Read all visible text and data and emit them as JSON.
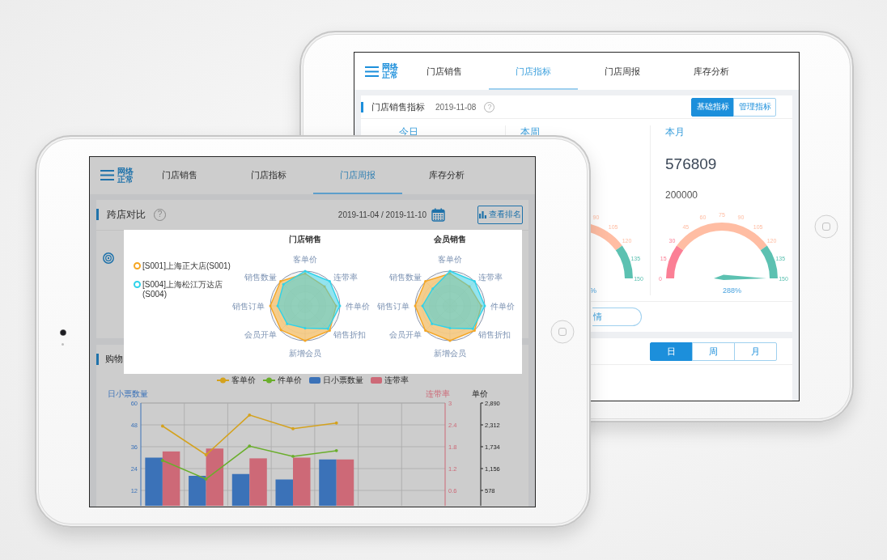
{
  "back_tablet": {
    "header": {
      "network_status": "网络正常",
      "tabs": [
        {
          "label": "门店销售",
          "selected": false
        },
        {
          "label": "门店指标",
          "selected": true
        },
        {
          "label": "门店周报",
          "selected": false
        },
        {
          "label": "库存分析",
          "selected": false
        }
      ]
    },
    "indicator_card": {
      "title": "门店销售指标",
      "date": "2019-11-08",
      "help": "?",
      "modes": [
        {
          "label": "基础指标",
          "selected": true
        },
        {
          "label": "管理指标",
          "selected": false
        }
      ],
      "periods": [
        {
          "label": "今日"
        },
        {
          "label": "本周",
          "gauge": {
            "ticks": [
              "90",
              "105",
              "120",
              "135",
              "150"
            ],
            "reading": "%"
          }
        },
        {
          "label": "本月",
          "value": "576809",
          "target": "200000",
          "gauge": {
            "ticks": [
              "0",
              "15",
              "30",
              "45",
              "60",
              "75",
              "90",
              "105",
              "120",
              "135",
              "150"
            ],
            "needle": true,
            "reading": "288%"
          }
        }
      ],
      "detail_button": "情"
    },
    "range_card": {
      "ranges": [
        {
          "label": "日",
          "selected": true
        },
        {
          "label": "周",
          "selected": false
        },
        {
          "label": "月",
          "selected": false
        }
      ]
    }
  },
  "front_tablet": {
    "header": {
      "network_status": "网络正常",
      "tabs": [
        {
          "label": "门店销售",
          "selected": false
        },
        {
          "label": "门店指标",
          "selected": false
        },
        {
          "label": "门店周报",
          "selected": true
        },
        {
          "label": "库存分析",
          "selected": false
        }
      ]
    },
    "compare_card": {
      "title": "跨店对比",
      "help": "?",
      "date_range": "2019-11-04 / 2019-11-10",
      "ranking_button": "查看排名"
    },
    "popup": {
      "legend": [
        {
          "label": "[S001]上海正大店(S001)",
          "color": "#f5a623"
        },
        {
          "label": "[S004]上海松江万达店(S004)",
          "color": "#2fd3ea"
        }
      ],
      "radars": [
        {
          "title": "门店销售",
          "axes": [
            "客单价",
            "销售数量",
            "连带率",
            "销售订单",
            "件单价",
            "会员开单",
            "销售折扣",
            "新增会员"
          ]
        },
        {
          "title": "会员销售",
          "axes": [
            "客单价",
            "销售数量",
            "连带率",
            "销售订单",
            "件单价",
            "会员开单",
            "销售折扣",
            "新增会员"
          ]
        }
      ]
    },
    "trend_card": {
      "title": "购物",
      "chart_data": {
        "type": "bar",
        "legend": "top",
        "grid": true,
        "ylabel": "日小票数量",
        "ylim": [
          0,
          60
        ],
        "yticks": [
          12,
          24,
          36,
          48,
          60
        ],
        "y2label": "连带率",
        "y2lim": [
          0,
          3
        ],
        "y2ticks": [
          0.6,
          1.2,
          1.8,
          2.4,
          3
        ],
        "y3label": "单价",
        "y3lim": [
          0,
          2890
        ],
        "y3ticks": [
          578,
          {
            "value": 1156,
            "label": "1,156"
          },
          {
            "value": 1734,
            "label": "1,734"
          },
          {
            "value": 2312,
            "label": "2,312"
          },
          {
            "value": 2890,
            "label": "2,890"
          }
        ],
        "series": [
          {
            "name": "客单价",
            "type": "line",
            "axis": "y3",
            "color": "#d4a21e",
            "values": [
              2280,
              1520,
              2570,
              2210,
              2360,
              null,
              null
            ]
          },
          {
            "name": "件单价",
            "type": "line",
            "axis": "y3",
            "color": "#6aae2b",
            "values": [
              1370,
              880,
              1750,
              1480,
              1630,
              null,
              null
            ]
          },
          {
            "name": "日小票数量",
            "type": "bar",
            "axis": "y",
            "color": "#3b72b8",
            "values": [
              30,
              20,
              21,
              18,
              29,
              null,
              null
            ]
          },
          {
            "name": "连带率",
            "type": "bar",
            "axis": "y2",
            "color": "#cd6977",
            "values": [
              1.67,
              1.75,
              1.48,
              1.5,
              1.45,
              null,
              null
            ]
          }
        ]
      }
    }
  }
}
